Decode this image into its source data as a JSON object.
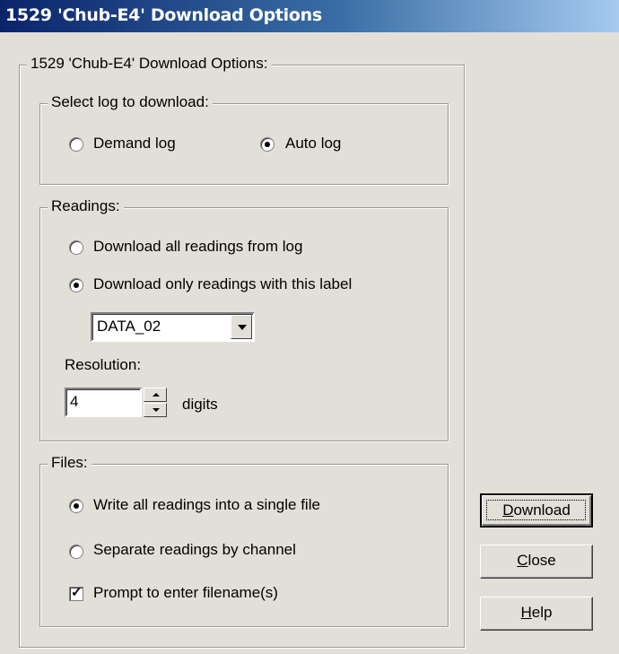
{
  "window": {
    "title": "1529 'Chub-E4' Download Options"
  },
  "main_group": {
    "legend": "1529 'Chub-E4' Download Options:"
  },
  "log_group": {
    "legend": "Select log to download:",
    "demand_label": "Demand log",
    "demand_checked": false,
    "auto_label": "Auto log",
    "auto_checked": true
  },
  "readings_group": {
    "legend": "Readings:",
    "all_label": "Download all readings from log",
    "all_checked": false,
    "only_label": "Download only readings with this label",
    "only_checked": true,
    "label_select_value": "DATA_02",
    "resolution_label": "Resolution:",
    "resolution_value": "4",
    "digits_label": "digits"
  },
  "files_group": {
    "legend": "Files:",
    "single_label": "Write all readings into a single file",
    "single_checked": true,
    "separate_label": "Separate readings by channel",
    "separate_checked": false,
    "prompt_label": "Prompt to enter filename(s)",
    "prompt_checked": true
  },
  "buttons": {
    "download_mnemonic": "D",
    "download_rest": "ownload",
    "close_mnemonic": "C",
    "close_rest": "lose",
    "help_mnemonic": "H",
    "help_rest": "elp"
  },
  "icons": {
    "dropdown": "chevron-down-icon",
    "spin_up": "arrow-up-icon",
    "spin_down": "arrow-down-icon",
    "check": "checkmark-icon"
  }
}
